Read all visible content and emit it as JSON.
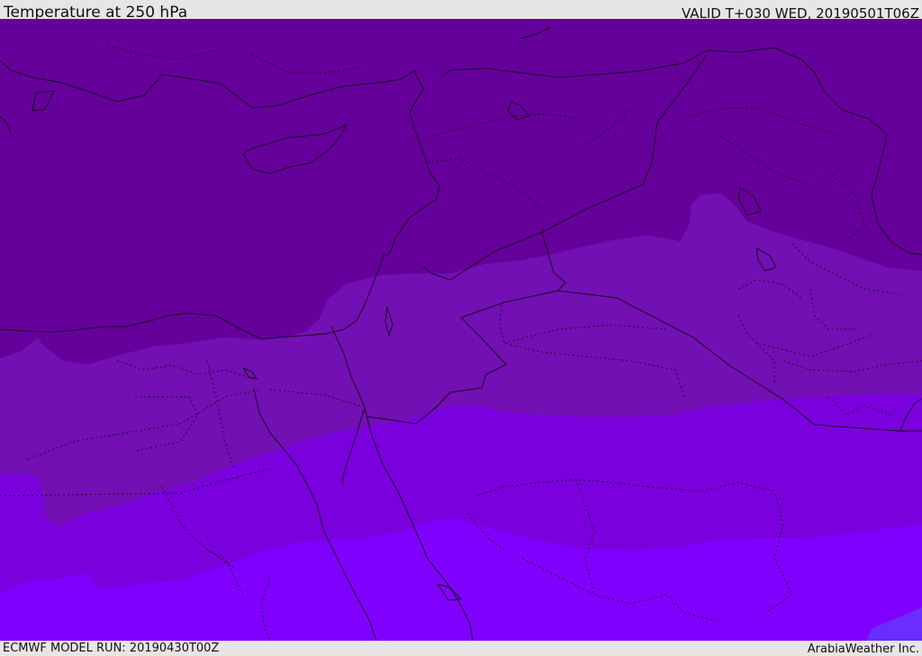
{
  "header": {
    "title": "Temperature at 250 hPa",
    "valid_time": "VALID T+030 WED, 20190501T06Z"
  },
  "footer": {
    "model_run": "ECMWF MODEL RUN: 20190430T00Z",
    "credit": "ArabiaWeather Inc."
  },
  "colors": {
    "band_coldest": "#65009b",
    "band_cold": "#7210b4",
    "band_mid": "#7a00de",
    "band_warm": "#8000ff",
    "band_warmest": "#6a2cff",
    "boundary_line": "#1a0a22",
    "bar_background": "#e6e6e6"
  }
}
